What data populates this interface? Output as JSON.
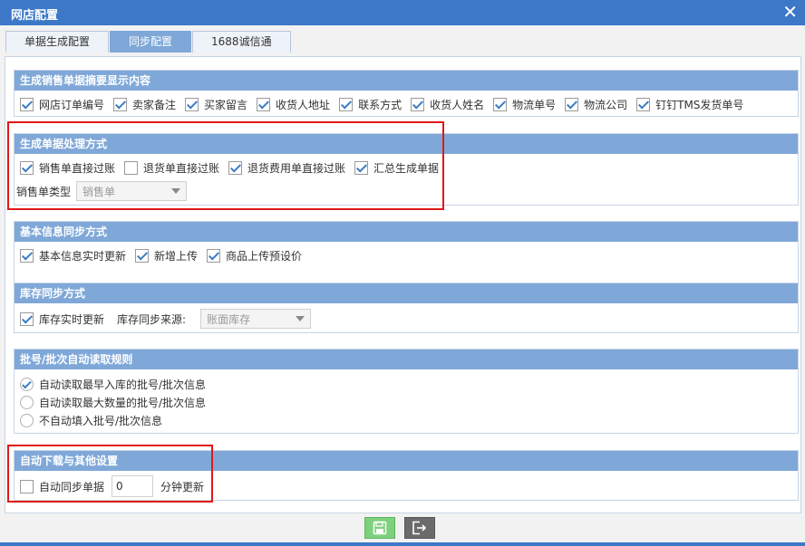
{
  "window": {
    "title": "网店配置",
    "close_glyph": "✕"
  },
  "tabs": [
    {
      "label": "单据生成配置",
      "active": false
    },
    {
      "label": "同步配置",
      "active": true
    },
    {
      "label": "1688诚信通",
      "active": false
    }
  ],
  "summary": {
    "header": "生成销售单据摘要显示内容",
    "items": [
      {
        "label": "网店订单编号",
        "checked": true
      },
      {
        "label": "卖家备注",
        "checked": true
      },
      {
        "label": "买家留言",
        "checked": true
      },
      {
        "label": "收货人地址",
        "checked": true
      },
      {
        "label": "联系方式",
        "checked": true
      },
      {
        "label": "收货人姓名",
        "checked": true
      },
      {
        "label": "物流单号",
        "checked": true
      },
      {
        "label": "物流公司",
        "checked": true
      },
      {
        "label": "钉钉TMS发货单号",
        "checked": true
      }
    ]
  },
  "processing": {
    "header": "生成单据处理方式",
    "items": [
      {
        "label": "销售单直接过账",
        "checked": true
      },
      {
        "label": "退货单直接过账",
        "checked": false
      },
      {
        "label": "退货费用单直接过账",
        "checked": true
      },
      {
        "label": "汇总生成单据",
        "checked": true
      }
    ],
    "type_label": "销售单类型",
    "type_value": "销售单"
  },
  "basic_sync": {
    "header": "基本信息同步方式",
    "items": [
      {
        "label": "基本信息实时更新",
        "checked": true
      },
      {
        "label": "新增上传",
        "checked": true
      },
      {
        "label": "商品上传预设价",
        "checked": true
      }
    ]
  },
  "stock_sync": {
    "header": "库存同步方式",
    "realtime_label": "库存实时更新",
    "realtime_checked": true,
    "source_label": "库存同步来源:",
    "source_value": "账面库存"
  },
  "batch_rule": {
    "header": "批号/批次自动读取规则",
    "options": [
      {
        "label": "自动读取最早入库的批号/批次信息",
        "checked": true
      },
      {
        "label": "自动读取最大数量的批号/批次信息",
        "checked": false
      },
      {
        "label": "不自动填入批号/批次信息",
        "checked": false
      }
    ]
  },
  "auto_download": {
    "header": "自动下载与其他设置",
    "sync_label": "自动同步单据",
    "sync_checked": false,
    "minutes_value": "0",
    "minutes_suffix": "分钟更新"
  },
  "footer": {
    "save_icon": "floppy-disk-icon",
    "exit_icon": "exit-icon"
  },
  "colors": {
    "titlebar": "#3c78c7",
    "group_header": "#7fa8d8",
    "highlight": "#e01818",
    "save_button": "#7ed07e",
    "exit_button": "#6b6b6b"
  }
}
